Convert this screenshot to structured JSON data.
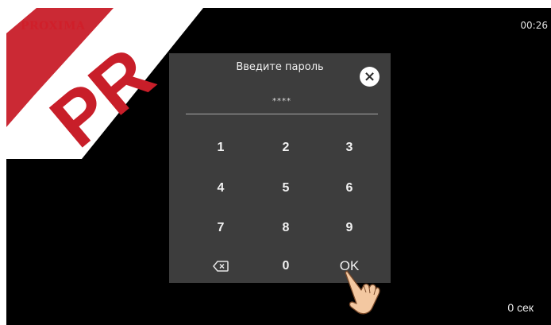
{
  "brand": {
    "name": "PROXIMA"
  },
  "status": {
    "clock": "00:26",
    "timer": "0 сек"
  },
  "dialog": {
    "title": "Введите пароль",
    "password_mask": "****",
    "close_icon": "close-icon",
    "keys": {
      "k1": "1",
      "k2": "2",
      "k3": "3",
      "k4": "4",
      "k5": "5",
      "k6": "6",
      "k7": "7",
      "k8": "8",
      "k9": "9",
      "k0": "0",
      "ok": "OK",
      "backspace_icon": "backspace-icon"
    }
  },
  "colors": {
    "brand_red": "#d01f2a",
    "panel_bg": "#3d3d3d",
    "screen_bg": "#000000"
  }
}
